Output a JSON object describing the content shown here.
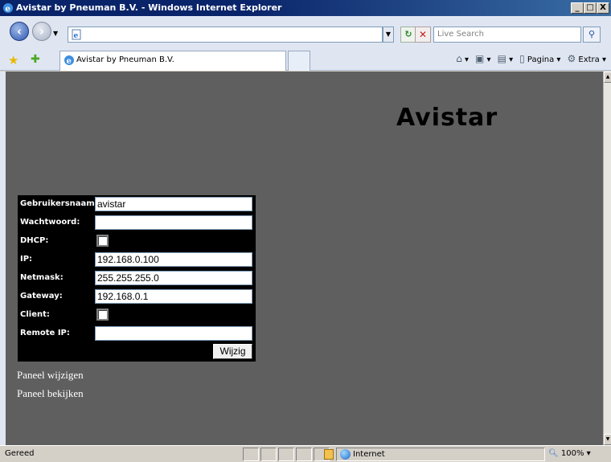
{
  "window": {
    "title": "Avistar by Pneuman B.V. - Windows Internet Explorer",
    "min": "_",
    "max": "□",
    "close": "X"
  },
  "browser": {
    "address_value": "",
    "search_placeholder": "Live Search",
    "tab_title": "Avistar by Pneuman B.V.",
    "cmd_page": "Pagina",
    "cmd_extra": "Extra"
  },
  "page": {
    "heading": "Avistar",
    "form": {
      "username_label": "Gebruikersnaam:",
      "username_value": "avistar",
      "password_label": "Wachtwoord:",
      "password_value": "",
      "dhcp_label": "DHCP:",
      "ip_label": "IP:",
      "ip_value": "192.168.0.100",
      "netmask_label": "Netmask:",
      "netmask_value": "255.255.255.0",
      "gateway_label": "Gateway:",
      "gateway_value": "192.168.0.1",
      "client_label": "Client:",
      "remote_ip_label": "Remote IP:",
      "remote_ip_value": "",
      "submit_label": "Wijzig"
    },
    "links": [
      "Paneel wijzigen",
      "Paneel bekijken"
    ]
  },
  "statusbar": {
    "status": "Gereed",
    "zone": "Internet",
    "zoom": "100%"
  }
}
